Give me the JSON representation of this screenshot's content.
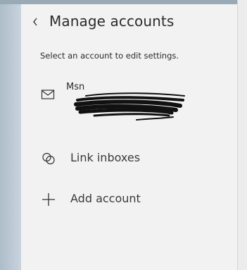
{
  "header": {
    "title": "Manage accounts",
    "back_icon": "chevron-left-icon"
  },
  "instructions": "Select an account to edit settings.",
  "accounts": [
    {
      "name": "Msn",
      "icon": "mail-icon",
      "email_redacted": true
    }
  ],
  "actions": [
    {
      "label": "Link inboxes",
      "icon": "link-inboxes-icon"
    },
    {
      "label": "Add account",
      "icon": "plus-icon"
    }
  ]
}
